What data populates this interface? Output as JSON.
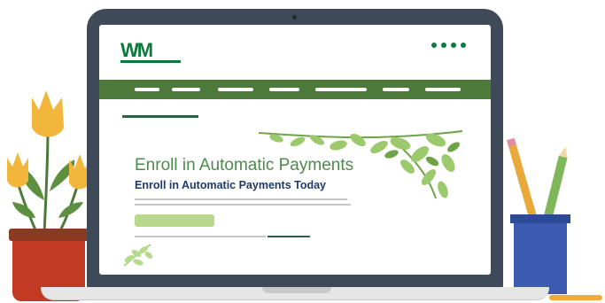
{
  "screen": {
    "logo": {
      "brand": "WM"
    },
    "nav": {
      "menu_dots": 4,
      "links": 6
    },
    "hero": {
      "title": "Enroll in Automatic Payments",
      "subtitle": "Enroll in Automatic Payments Today"
    }
  },
  "colors": {
    "brand_green": "#0b7a3b",
    "nav_green": "#4d7a3a",
    "heading_green": "#4d8a4e",
    "navy": "#1c3a6b",
    "cta_green": "#b6d98b",
    "laptop_frame": "#3f4a58",
    "pot_red": "#c23a24",
    "cup_blue": "#3d5bb0"
  },
  "icons": [
    "tulip-plant-illustration",
    "leaf-branch-illustration",
    "pencil-cup-illustration",
    "menu-dots-icon"
  ]
}
